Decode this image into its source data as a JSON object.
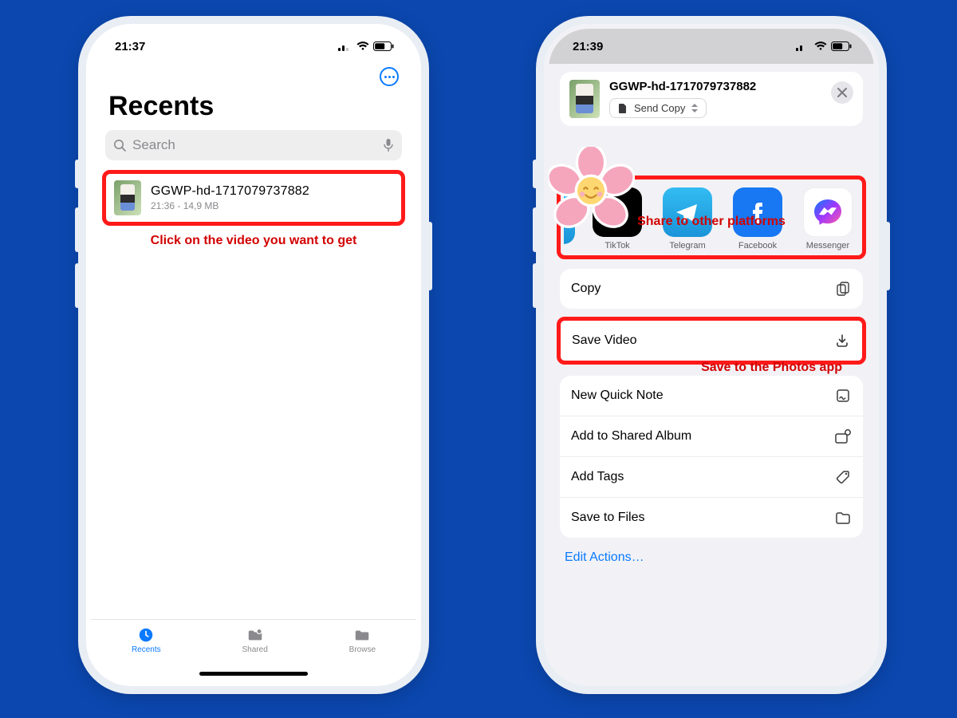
{
  "left": {
    "status_time": "21:37",
    "title": "Recents",
    "search_placeholder": "Search",
    "file": {
      "name": "GGWP-hd-1717079737882",
      "meta": "21:36 - 14,9 MB"
    },
    "annotation": "Click on the video you want to get",
    "tabs": {
      "recents": "Recents",
      "shared": "Shared",
      "browse": "Browse"
    }
  },
  "right": {
    "status_time": "21:39",
    "file_name": "GGWP-hd-1717079737882",
    "send_copy": "Send Copy",
    "share_annotation": "Share to other platforms",
    "share": {
      "tiktok": "TikTok",
      "telegram": "Telegram",
      "facebook": "Facebook",
      "messenger": "Messenger"
    },
    "actions": {
      "copy": "Copy",
      "save_video": "Save Video",
      "new_quick_note": "New Quick Note",
      "add_shared_album": "Add to Shared Album",
      "add_tags": "Add Tags",
      "save_to_files": "Save to Files"
    },
    "save_annotation": "Save to the Photos app",
    "edit_actions": "Edit Actions…"
  }
}
